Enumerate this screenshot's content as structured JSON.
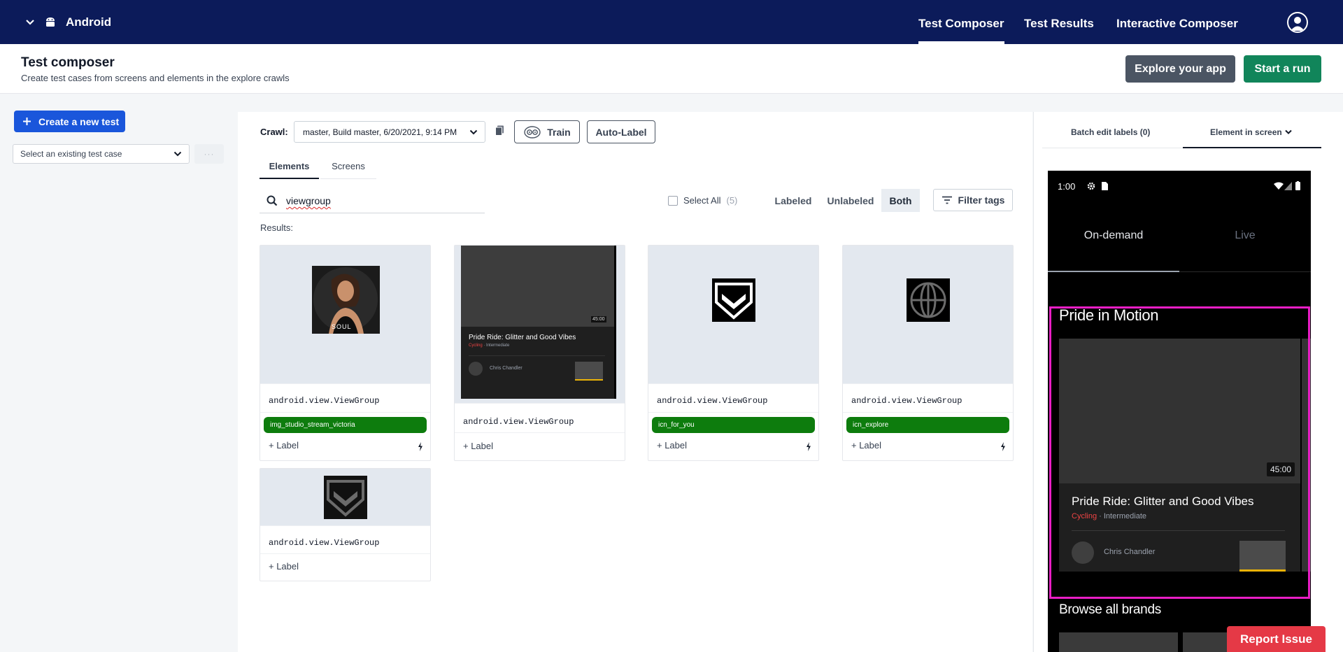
{
  "nav": {
    "platform": "Android",
    "links": [
      "Test Composer",
      "Test Results",
      "Interactive Composer"
    ],
    "active_link": "Test Composer"
  },
  "header": {
    "title": "Test composer",
    "subtitle": "Create test cases from screens and elements in the explore crawls",
    "explore_button": "Explore your app",
    "run_button": "Start a run"
  },
  "sidebar": {
    "create_button": "Create a new test",
    "select_placeholder": "Select an existing test case",
    "more_label": "···"
  },
  "main": {
    "crawl_label": "Crawl:",
    "crawl_value": "master, Build master, 6/20/2021, 9:14 PM",
    "train_button": "Train",
    "autolabel_button": "Auto-Label",
    "tabs": [
      "Elements",
      "Screens"
    ],
    "search_value": "viewgroup",
    "select_all": "Select All",
    "select_all_count": "(5)",
    "segments": [
      "Labeled",
      "Unlabeled",
      "Both"
    ],
    "active_segment": "Both",
    "filter_button": "Filter tags",
    "results_label": "Results:",
    "cards": [
      {
        "class_name": "android.view.ViewGroup",
        "tag": "img_studio_stream_victoria",
        "add_label": "+ Label"
      },
      {
        "class_name": "android.view.ViewGroup",
        "tag": "",
        "add_label": "+ Label"
      },
      {
        "class_name": "android.view.ViewGroup",
        "tag": "icn_for_you",
        "add_label": "+ Label"
      },
      {
        "class_name": "android.view.ViewGroup",
        "tag": "icn_explore",
        "add_label": "+ Label"
      },
      {
        "class_name": "android.view.ViewGroup",
        "tag": "",
        "add_label": "+ Label"
      }
    ],
    "card2_thumb": {
      "duration": "45:00",
      "title": "Pride Ride: Glitter and Good Vibes",
      "category": "Cycling",
      "level": "· Intermediate",
      "instructor": "Chris Chandler"
    },
    "card1_thumb_text": "SOUL"
  },
  "right_panel": {
    "tab_batch": "Batch edit labels (0)",
    "tab_element": "Element in screen",
    "phone": {
      "time": "1:00",
      "seg_on": "On-demand",
      "seg_live": "Live",
      "section_title": "Pride in Motion",
      "duration": "45:00",
      "class_title": "Pride Ride: Glitter and Good Vibes",
      "category": "Cycling",
      "level": "· Intermediate",
      "instructor": "Chris Chandler",
      "next_section": "Browse all brands"
    }
  },
  "report_button": "Report Issue",
  "colors": {
    "nav_bg": "#0c1b5a",
    "primary": "#1a56db",
    "success": "#11855a",
    "tag_green": "#0d7c0d",
    "highlight": "#e91ec5",
    "report": "#e53946"
  }
}
